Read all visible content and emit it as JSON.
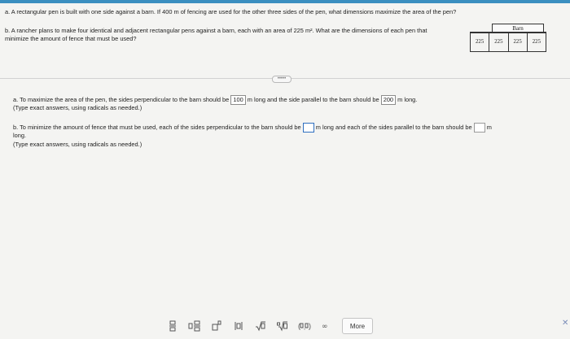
{
  "question_a": "a. A rectangular pen is built with one side against a barn. If 400 m of fencing are used for the other three sides of the pen, what dimensions maximize the area of the pen?",
  "question_b": "b. A rancher plans to make four identical and adjacent rectangular pens against a barn, each with an area of 225 m². What are the dimensions of each pen that minimize the amount of fence that must be used?",
  "figure": {
    "barn_label": "Barn",
    "pen_labels": [
      "225",
      "225",
      "225",
      "225"
    ]
  },
  "expand_label": "•••••",
  "answer_a": {
    "prefix": "a. To maximize the area of the pen, the sides perpendicular to the barn should be",
    "value1": "100",
    "mid": "m long and the side parallel to the barn should be",
    "value2": "200",
    "suffix": "m long.",
    "note": "(Type exact answers, using radicals as needed.)"
  },
  "answer_b": {
    "prefix": "b. To minimize the amount of fence that must be used, each of the sides perpendicular to the barn should be",
    "mid": "m long and each of the sides parallel to the barn should be",
    "unit": "m",
    "suffix": "long.",
    "note": "(Type exact answers, using radicals as needed.)"
  },
  "toolbar": {
    "buttons": [
      "fraction",
      "mixed number",
      "exponent",
      "absolute value",
      "sqrt",
      "nth root",
      "ordered pair",
      "infinity"
    ],
    "more_label": "More",
    "close_label": "✕"
  },
  "colors": {
    "accent_bar": "#3b8fc0",
    "active_box": "#2f6fc0"
  }
}
